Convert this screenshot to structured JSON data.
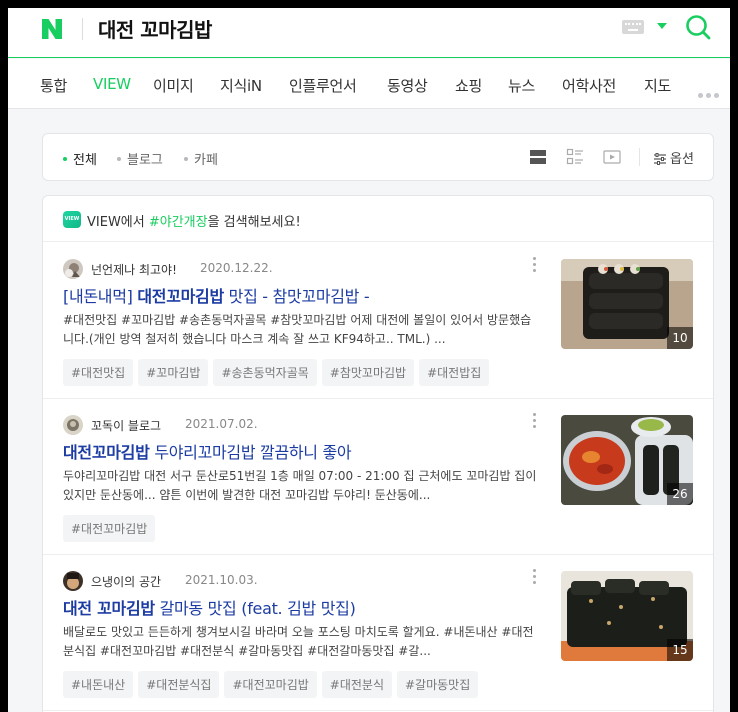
{
  "header": {
    "logo_letter": "N",
    "search_query": "대전 꼬마김밥",
    "brand_color": "#19ce60"
  },
  "tabs": [
    {
      "label": "통합",
      "active": false
    },
    {
      "label": "VIEW",
      "active": true
    },
    {
      "label": "이미지",
      "active": false
    },
    {
      "label": "지식iN",
      "active": false
    },
    {
      "label": "인플루언서",
      "active": false
    },
    {
      "label": "동영상",
      "active": false
    },
    {
      "label": "쇼핑",
      "active": false
    },
    {
      "label": "뉴스",
      "active": false
    },
    {
      "label": "어학사전",
      "active": false
    },
    {
      "label": "지도",
      "active": false
    }
  ],
  "filter": {
    "items": [
      {
        "label": "전체",
        "active": true
      },
      {
        "label": "블로그",
        "active": false
      },
      {
        "label": "카페",
        "active": false
      }
    ],
    "view_icons": [
      "list-view-icon",
      "thumbnail-view-icon",
      "video-view-icon"
    ],
    "options_label": "옵션"
  },
  "suggest": {
    "badge": "VIEW",
    "prefix": "VIEW에서 ",
    "keyword": "#야간개장",
    "suffix": "을 검색해보세요!"
  },
  "posts": [
    {
      "author": "넌언제나 최고야!",
      "date": "2020.12.22.",
      "title_pre": "[내돈내먹] ",
      "title_bold": "대전꼬마김밥",
      "title_post": " 맛집 - 참맛꼬마김밥 -",
      "desc": "#대전맛집 #꼬마김밥 #송촌동먹자골목 #참맛꼬마김밥 어제 대전에 볼일이 있어서 방문했습니다.(개인 방역 철저히 했습니다 마스크 계속 잘 쓰고 KF94하고.. TML.) ...",
      "tags": [
        "#대전맛집",
        "#꼬마김밥",
        "#송촌동먹자골목",
        "#참맛꼬마김밥",
        "#대전밥집"
      ],
      "image_count": "10"
    },
    {
      "author": "꼬독이 블로그",
      "date": "2021.07.02.",
      "title_pre": "",
      "title_bold": "대전꼬마김밥",
      "title_post": " 두야리꼬마김밥 깔끔하니 좋아",
      "desc": "두야리꼬마김밥 대전 서구 둔산로51번길 1층 매일 07:00 - 21:00 집 근처에도 꼬마김밥 집이 있지만 둔산동에... 얌튼 이번에 발견한 대전 꼬마김밥 두야리! 둔산동에...",
      "tags": [
        "#대전꼬마김밥"
      ],
      "image_count": "26"
    },
    {
      "author": "으냉이의 공간",
      "date": "2021.10.03.",
      "title_pre": "",
      "title_bold": "대전 꼬마김밥",
      "title_post": " 갈마동 맛집 (feat. 김밥 맛집)",
      "desc": "배달로도 맛있고 든든하게 챙겨보시길 바라며 오늘 포스팅 마치도록 할게요. #내돈내산 #대전분식집 #대전꼬마김밥 #대전분식 #갈마동맛집 #대전갈마동맛집 #갈...",
      "tags": [
        "#내돈내산",
        "#대전분식집",
        "#대전꼬마김밥",
        "#대전분식",
        "#갈마동맛집"
      ],
      "image_count": "15"
    }
  ]
}
